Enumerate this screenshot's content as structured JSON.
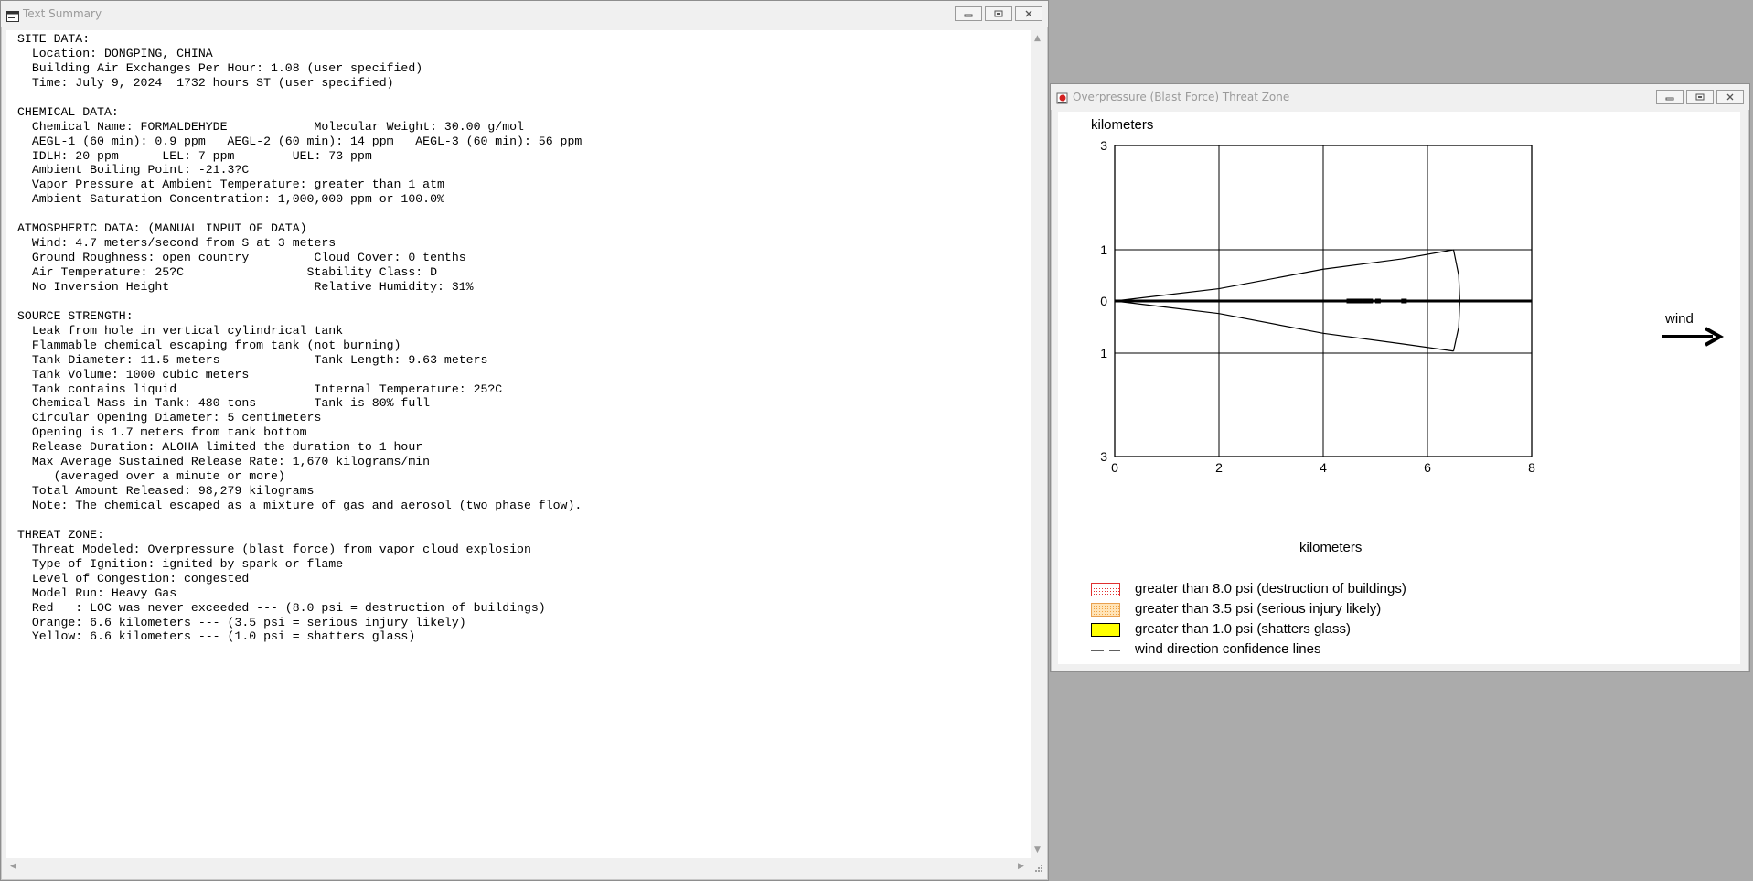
{
  "text_window": {
    "title": "Text Summary",
    "summary_text": "SITE DATA:\n  Location: DONGPING, CHINA\n  Building Air Exchanges Per Hour: 1.08 (user specified)\n  Time: July 9, 2024  1732 hours ST (user specified)\n\nCHEMICAL DATA:\n  Chemical Name: FORMALDEHYDE            Molecular Weight: 30.00 g/mol\n  AEGL-1 (60 min): 0.9 ppm   AEGL-2 (60 min): 14 ppm   AEGL-3 (60 min): 56 ppm\n  IDLH: 20 ppm      LEL: 7 ppm        UEL: 73 ppm\n  Ambient Boiling Point: -21.3?C\n  Vapor Pressure at Ambient Temperature: greater than 1 atm\n  Ambient Saturation Concentration: 1,000,000 ppm or 100.0%\n\nATMOSPHERIC DATA: (MANUAL INPUT OF DATA)\n  Wind: 4.7 meters/second from S at 3 meters\n  Ground Roughness: open country         Cloud Cover: 0 tenths\n  Air Temperature: 25?C                 Stability Class: D\n  No Inversion Height                    Relative Humidity: 31%\n\nSOURCE STRENGTH:\n  Leak from hole in vertical cylindrical tank\n  Flammable chemical escaping from tank (not burning)\n  Tank Diameter: 11.5 meters             Tank Length: 9.63 meters\n  Tank Volume: 1000 cubic meters\n  Tank contains liquid                   Internal Temperature: 25?C\n  Chemical Mass in Tank: 480 tons        Tank is 80% full\n  Circular Opening Diameter: 5 centimeters\n  Opening is 1.7 meters from tank bottom\n  Release Duration: ALOHA limited the duration to 1 hour\n  Max Average Sustained Release Rate: 1,670 kilograms/min\n     (averaged over a minute or more)\n  Total Amount Released: 98,279 kilograms\n  Note: The chemical escaped as a mixture of gas and aerosol (two phase flow).\n\nTHREAT ZONE:\n  Threat Modeled: Overpressure (blast force) from vapor cloud explosion\n  Type of Ignition: ignited by spark or flame\n  Level of Congestion: congested\n  Model Run: Heavy Gas\n  Red   : LOC was never exceeded --- (8.0 psi = destruction of buildings)\n  Orange: 6.6 kilometers --- (3.5 psi = serious injury likely)\n  Yellow: 6.6 kilometers --- (1.0 psi = shatters glass)"
  },
  "threat_window": {
    "title": "Overpressure (Blast Force) Threat Zone",
    "wind_label": "wind",
    "legend": [
      {
        "text": "greater than 8.0 psi (destruction of buildings)",
        "color": "#ff9a9a",
        "pattern": "dotted-red"
      },
      {
        "text": "greater than 3.5 psi (serious injury likely)",
        "color": "#ffcc88",
        "pattern": "dotted-orange"
      },
      {
        "text": "greater than 1.0 psi (shatters glass)",
        "color": "#ffff00",
        "pattern": "solid-yellow"
      },
      {
        "text": "wind direction confidence lines",
        "color": "#000000",
        "pattern": "dashed-line"
      }
    ]
  },
  "chart_data": {
    "type": "line",
    "title": "",
    "xlabel": "kilometers",
    "ylabel": "kilometers",
    "xlim": [
      0,
      8
    ],
    "ylim": [
      -3,
      3
    ],
    "x_ticks": [
      "0",
      "2",
      "4",
      "6",
      "8"
    ],
    "y_ticks": [
      {
        "value": 3,
        "label": "3"
      },
      {
        "value": 1,
        "label": "1"
      },
      {
        "value": 0,
        "label": "0"
      },
      {
        "value": -1,
        "label": "1"
      },
      {
        "value": -3,
        "label": "3"
      }
    ],
    "grid": true,
    "series": [
      {
        "values": [
          [
            0,
            0
          ],
          [
            2,
            0.24
          ],
          [
            4,
            0.62
          ],
          [
            5.5,
            0.82
          ],
          [
            6.5,
            1.0
          ]
        ]
      },
      {
        "values": [
          [
            0,
            0
          ],
          [
            2,
            -0.24
          ],
          [
            4,
            -0.62
          ],
          [
            5.5,
            -0.82
          ],
          [
            6.5,
            -0.96
          ]
        ]
      },
      {
        "values": [
          [
            6.5,
            1.0
          ],
          [
            6.6,
            0.5
          ],
          [
            6.62,
            0
          ],
          [
            6.6,
            -0.5
          ],
          [
            6.5,
            -0.96
          ]
        ]
      },
      {
        "values": [
          [
            0,
            0
          ],
          [
            8,
            0
          ]
        ]
      }
    ],
    "threat_zone_km": 6.6,
    "wind_direction": "east"
  }
}
